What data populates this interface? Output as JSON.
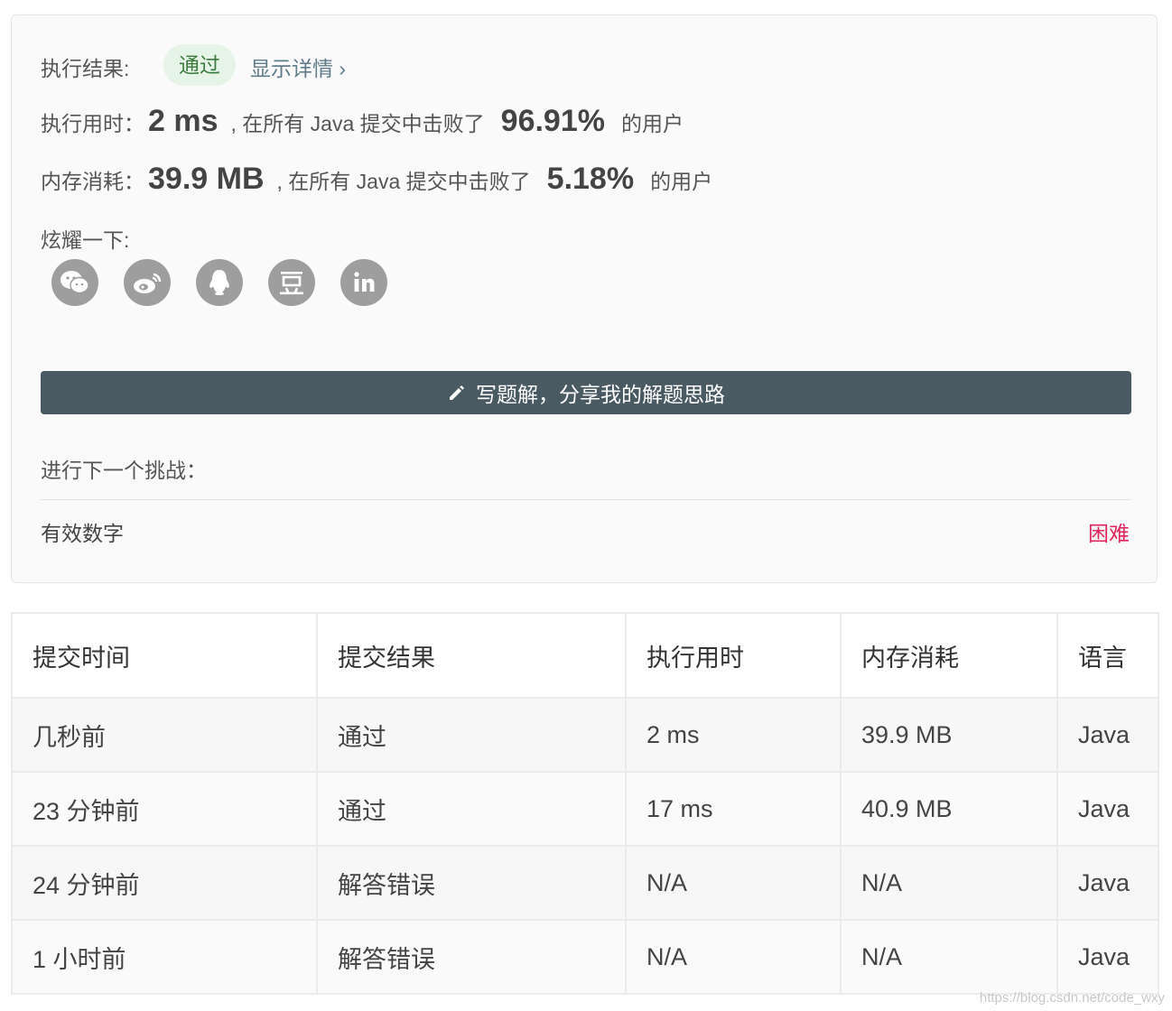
{
  "result": {
    "label": "执行结果:",
    "status": "通过",
    "details_link": "显示详情 ›"
  },
  "runtime": {
    "label": "执行用时：",
    "value": "2 ms",
    "mid_text": ", 在所有 Java 提交中击败了",
    "percent": "96.91%",
    "suffix": "的用户"
  },
  "memory": {
    "label": "内存消耗：",
    "value": "39.9 MB",
    "mid_text": ", 在所有 Java 提交中击败了",
    "percent": "5.18%",
    "suffix": "的用户"
  },
  "share": {
    "label": "炫耀一下:",
    "icons": [
      "wechat-icon",
      "weibo-icon",
      "qq-icon",
      "douban-icon",
      "linkedin-icon"
    ]
  },
  "write_button": {
    "label": "写题解，分享我的解题思路",
    "icon": "pencil-icon"
  },
  "next_challenge": {
    "label": "进行下一个挑战：",
    "problem_title": "有效数字",
    "difficulty": "困难"
  },
  "submissions": {
    "headers": [
      "提交时间",
      "提交结果",
      "执行用时",
      "内存消耗",
      "语言"
    ],
    "rows": [
      {
        "time": "几秒前",
        "result": "通过",
        "runtime": "2 ms",
        "memory": "39.9 MB",
        "language": "Java"
      },
      {
        "time": "23 分钟前",
        "result": "通过",
        "runtime": "17 ms",
        "memory": "40.9 MB",
        "language": "Java"
      },
      {
        "time": "24 分钟前",
        "result": "解答错误",
        "runtime": "N/A",
        "memory": "N/A",
        "language": "Java"
      },
      {
        "time": "1 小时前",
        "result": "解答错误",
        "runtime": "N/A",
        "memory": "N/A",
        "language": "Java"
      }
    ]
  },
  "watermark": "https://blog.csdn.net/code_wxy",
  "colors": {
    "pass": "#3c9a8a",
    "fail": "#c0392b",
    "hard": "#e0245e",
    "button_bg": "#4a5a63",
    "badge_bg": "#e6f4e8"
  }
}
